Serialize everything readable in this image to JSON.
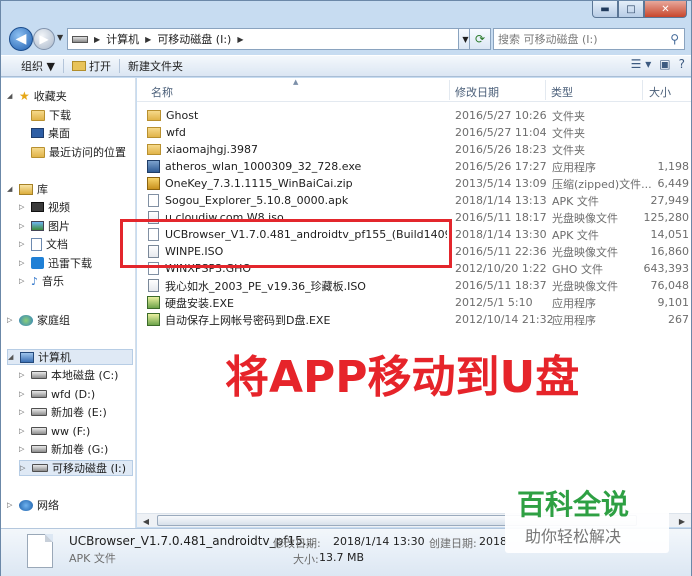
{
  "window": {
    "caption_min": "▬",
    "caption_max": "□",
    "caption_close": "✕"
  },
  "address": {
    "crumbs": [
      "计算机",
      "可移动磁盘 (I:)"
    ],
    "search_placeholder": "搜索 可移动磁盘 (I:)"
  },
  "toolbar": {
    "organize": "组织 ▼",
    "open": "打开",
    "new_folder": "新建文件夹"
  },
  "nav": {
    "favorites": "收藏夹",
    "downloads": "下载",
    "desktop": "桌面",
    "recent": "最近访问的位置",
    "libraries": "库",
    "videos": "视频",
    "pictures": "图片",
    "documents": "文档",
    "xunlei": "迅雷下载",
    "music": "音乐",
    "homegroup": "家庭组",
    "computer": "计算机",
    "drive_c": "本地磁盘 (C:)",
    "drive_d": "wfd (D:)",
    "drive_e": "新加卷 (E:)",
    "drive_f": "ww (F:)",
    "drive_g": "新加卷 (G:)",
    "drive_i": "可移动磁盘 (I:)",
    "network": "网络"
  },
  "columns": {
    "name": "名称",
    "date": "修改日期",
    "type": "类型",
    "size": "大小"
  },
  "files": [
    {
      "name": "Ghost",
      "date": "2016/5/27 10:26",
      "type": "文件夹",
      "size": "",
      "icon": "folder"
    },
    {
      "name": "wfd",
      "date": "2016/5/27 11:04",
      "type": "文件夹",
      "size": "",
      "icon": "folder"
    },
    {
      "name": "xiaomajhgj.3987",
      "date": "2016/5/26 18:23",
      "type": "文件夹",
      "size": "",
      "icon": "folder"
    },
    {
      "name": "atheros_wlan_1000309_32_728.exe",
      "date": "2016/5/26 17:27",
      "type": "应用程序",
      "size": "1,198",
      "icon": "exe"
    },
    {
      "name": "OneKey_7.3.1.1115_WinBaiCai.zip",
      "date": "2013/5/14 13:09",
      "type": "压缩(zipped)文件...",
      "size": "6,449",
      "icon": "zip"
    },
    {
      "name": "Sogou_Explorer_5.10.8_0000.apk",
      "date": "2018/1/14 13:13",
      "type": "APK 文件",
      "size": "27,949",
      "icon": "file"
    },
    {
      "name": "u.cloudiw.com.W8.iso",
      "date": "2016/5/11 18:17",
      "type": "光盘映像文件",
      "size": "125,280",
      "icon": "iso"
    },
    {
      "name": "UCBrowser_V1.7.0.481_androidtv_pf155_(Build14092514)....",
      "date": "2018/1/14 13:30",
      "type": "APK 文件",
      "size": "14,051",
      "icon": "file"
    },
    {
      "name": "WINPE.ISO",
      "date": "2016/5/11 22:36",
      "type": "光盘映像文件",
      "size": "16,860",
      "icon": "iso"
    },
    {
      "name": "WINXPSP3.GHO",
      "date": "2012/10/20 1:22",
      "type": "GHO 文件",
      "size": "643,393",
      "icon": "file"
    },
    {
      "name": "我心如水_2003_PE_v19.36_珍藏板.ISO",
      "date": "2016/5/11 18:37",
      "type": "光盘映像文件",
      "size": "76,048",
      "icon": "iso"
    },
    {
      "name": "硬盘安装.EXE",
      "date": "2012/5/1 5:10",
      "type": "应用程序",
      "size": "9,101",
      "icon": "app"
    },
    {
      "name": "自动保存上网帐号密码到D盘.EXE",
      "date": "2012/10/14 21:32",
      "type": "应用程序",
      "size": "267",
      "icon": "app"
    }
  ],
  "overlay": {
    "caption": "将APP移动到U盘"
  },
  "details": {
    "name": "UCBrowser_V1.7.0.481_androidtv_pf15...",
    "type": "APK 文件",
    "modified_label": "修改日期:",
    "modified_value": "2018/1/14 13:30",
    "size_label": "大小:",
    "size_value": "13.7 MB",
    "created_label": "创建日期:",
    "created_value": "2018"
  },
  "watermark": {
    "title": "百科全说",
    "subtitle": "助你轻松解决"
  },
  "colors": {
    "highlight": "#e3262c",
    "overlay_text": "#e6242a",
    "watermark_title": "#2ea043"
  }
}
